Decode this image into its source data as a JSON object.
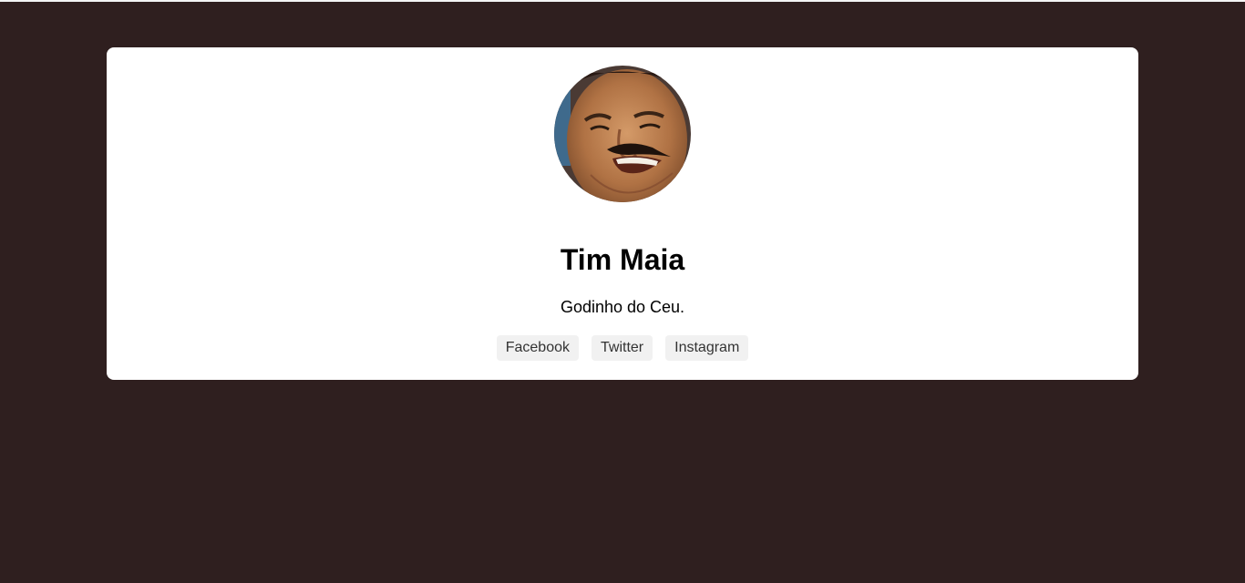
{
  "profile": {
    "name": "Tim Maia",
    "tagline": "Godinho do Ceu.",
    "avatar_alt": "Tim Maia"
  },
  "links": [
    {
      "label": "Facebook"
    },
    {
      "label": "Twitter"
    },
    {
      "label": "Instagram"
    }
  ],
  "colors": {
    "page_background": "#2f1f1f",
    "card_background": "#ffffff",
    "link_background": "#f1f1f1"
  }
}
